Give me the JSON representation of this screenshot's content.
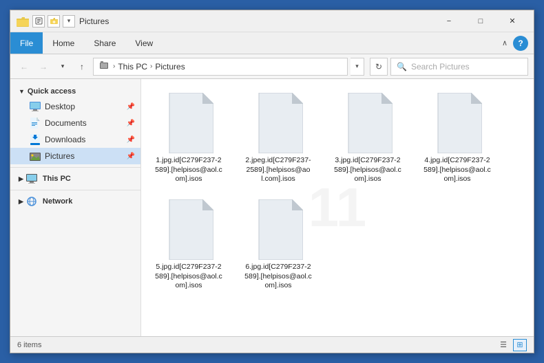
{
  "window": {
    "title": "Pictures",
    "icon": "folder-icon"
  },
  "title_bar": {
    "quick_access_buttons": [
      "pin-btn",
      "undo-btn"
    ],
    "title": "Pictures",
    "minimize_label": "−",
    "maximize_label": "□",
    "close_label": "✕"
  },
  "ribbon": {
    "tabs": [
      {
        "label": "File",
        "active": true
      },
      {
        "label": "Home",
        "active": false
      },
      {
        "label": "Share",
        "active": false
      },
      {
        "label": "View",
        "active": false
      }
    ],
    "help_label": "?"
  },
  "address_bar": {
    "back_title": "Back",
    "forward_title": "Forward",
    "recent_title": "Recent locations",
    "up_title": "Up",
    "path_parts": [
      {
        "label": "This PC",
        "separator": true
      },
      {
        "label": "Pictures",
        "separator": false
      }
    ],
    "refresh_title": "Refresh",
    "search_placeholder": "Search Pictures"
  },
  "sidebar": {
    "quick_access_label": "Quick access",
    "items": [
      {
        "label": "Desktop",
        "icon": "desktop-icon",
        "pinned": true
      },
      {
        "label": "Documents",
        "icon": "documents-icon",
        "pinned": true
      },
      {
        "label": "Downloads",
        "icon": "downloads-icon",
        "pinned": true
      },
      {
        "label": "Pictures",
        "icon": "pictures-icon",
        "pinned": true,
        "active": true
      }
    ],
    "this_pc_label": "This PC",
    "network_label": "Network"
  },
  "files": [
    {
      "name": "1.jpg.id[C279F237-2589].[helpisos@aol.com].isos"
    },
    {
      "name": "2.jpeg.id[C279F237-2589].[helpisos@aol.com].isos"
    },
    {
      "name": "3.jpg.id[C279F237-2589].[helpisos@aol.com].isos"
    },
    {
      "name": "4.jpg.id[C279F237-2589].[helpisos@aol.com].isos"
    },
    {
      "name": "5.jpg.id[C279F237-2589].[helpisos@aol.com].isos"
    },
    {
      "name": "6.jpg.id[C279F237-2589].[helpisos@aol.com].isos"
    }
  ],
  "status_bar": {
    "item_count": "6 items"
  },
  "colors": {
    "accent": "#2a8dd4",
    "active_tab": "#2a8dd4",
    "sidebar_active": "#cce0f5"
  }
}
